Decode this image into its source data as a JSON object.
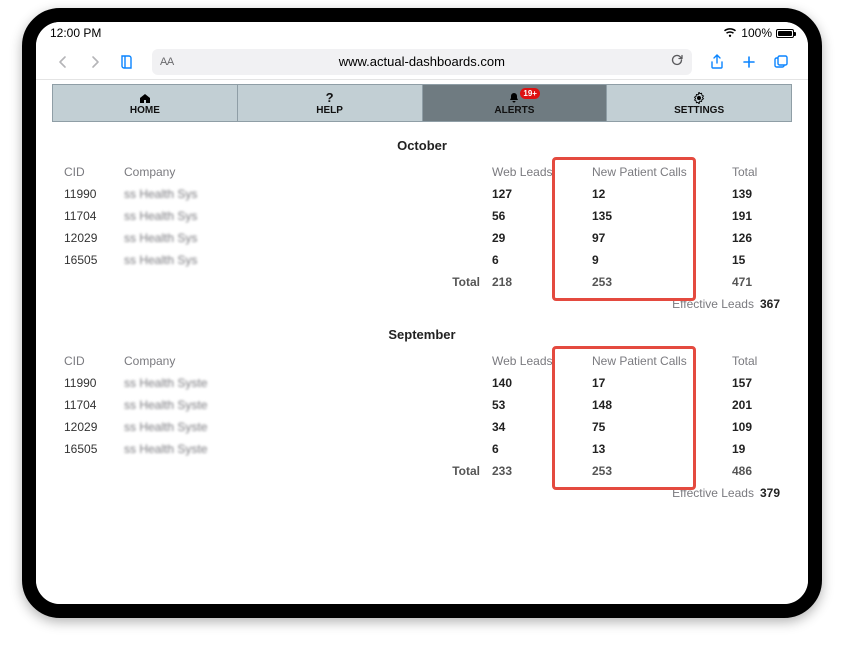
{
  "status": {
    "time": "12:00 PM",
    "battery": "100%",
    "wifi": "wifi"
  },
  "browser": {
    "url": "www.actual-dashboards.com",
    "aA": "AA",
    "back": "‹",
    "forward": "›"
  },
  "tabs": {
    "home": "HOME",
    "help": "HELP",
    "alerts": "ALERTS",
    "alerts_badge": "19+",
    "settings": "SETTINGS"
  },
  "headers": {
    "cid": "CID",
    "company": "Company",
    "web_leads": "Web Leads",
    "new_calls": "New Patient Calls",
    "total": "Total",
    "row_total_label": "Total",
    "effective": "Effective Leads"
  },
  "oct": {
    "title": "October",
    "rows": [
      {
        "cid": "11990",
        "company": "ss Health Sys",
        "web": "127",
        "calls": "12",
        "total": "139"
      },
      {
        "cid": "11704",
        "company": "ss Health Sys",
        "web": "56",
        "calls": "135",
        "total": "191"
      },
      {
        "cid": "12029",
        "company": "ss Health Sys",
        "web": "29",
        "calls": "97",
        "total": "126"
      },
      {
        "cid": "16505",
        "company": "ss Health Sys",
        "web": "6",
        "calls": "9",
        "total": "15"
      }
    ],
    "sum": {
      "web": "218",
      "calls": "253",
      "total": "471"
    },
    "effective": "367"
  },
  "sep": {
    "title": "September",
    "rows": [
      {
        "cid": "11990",
        "company": "ss Health Syste",
        "web": "140",
        "calls": "17",
        "total": "157"
      },
      {
        "cid": "11704",
        "company": "ss Health Syste",
        "web": "53",
        "calls": "148",
        "total": "201"
      },
      {
        "cid": "12029",
        "company": "ss Health Syste",
        "web": "34",
        "calls": "75",
        "total": "109"
      },
      {
        "cid": "16505",
        "company": "ss Health Syste",
        "web": "6",
        "calls": "13",
        "total": "19"
      }
    ],
    "sum": {
      "web": "233",
      "calls": "253",
      "total": "486"
    },
    "effective": "379"
  }
}
